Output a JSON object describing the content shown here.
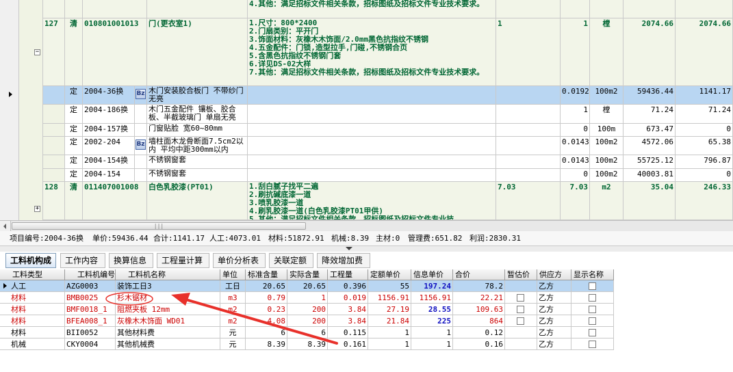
{
  "top_grid": {
    "row0_desc": "4.其他：满足招标文件相关条款，招标图纸及招标文件专业技术要求。",
    "row127": {
      "num": "127",
      "kind": "清",
      "code": "010801001013",
      "name": "门(更衣室1)",
      "desc": "1.尺寸：800*2400\n2.门扇类别：平开门\n3.饰面材料：灰橡木木饰面/2.0mm黑色抗指纹不锈钢\n4.五金配件：门锁,造型拉手,门碰,不锈钢合页\n5.含黑色抗指纹不锈钢门套\n6.详见DS-02大样\n7.其他：满足招标文件相关条款，招标图纸及招标文件专业技术要求。",
      "qty_expr": "1",
      "qty": "1",
      "unit": "樘",
      "price": "2074.66",
      "total": "2074.66",
      "toggle": "−"
    },
    "subrows": [
      {
        "kind": "定",
        "code": "2004-36换",
        "bz": "Bz",
        "name": "木门安装胶合板门 不带纱门 无亮",
        "qty": "0.0192",
        "unit": "100m2",
        "price": "59436.44",
        "total": "1141.17"
      },
      {
        "kind": "定",
        "code": "2004-186换",
        "bz": "",
        "name": "木门五金配件 镶板、胶合板、半截玻璃门 单扇无亮",
        "qty": "1",
        "unit": "樘",
        "price": "71.24",
        "total": "71.24"
      },
      {
        "kind": "定",
        "code": "2004-157换",
        "bz": "",
        "name": "门窗贴脸 宽60~80mm",
        "qty": "0",
        "unit": "100m",
        "price": "673.47",
        "total": "0"
      },
      {
        "kind": "定",
        "code": "2002-204",
        "bz": "Bz",
        "name": "墙柱面木龙骨断面7.5cm2以内 平均中距300mm以内",
        "qty": "0.0143",
        "unit": "100m2",
        "price": "4572.06",
        "total": "65.38"
      },
      {
        "kind": "定",
        "code": "2004-154换",
        "bz": "",
        "name": "不锈钢窗套",
        "qty": "0.0143",
        "unit": "100m2",
        "price": "55725.12",
        "total": "796.87"
      },
      {
        "kind": "定",
        "code": "2004-154",
        "bz": "",
        "name": "不锈钢窗套",
        "qty": "0",
        "unit": "100m2",
        "price": "40003.81",
        "total": "0"
      }
    ],
    "row128": {
      "num": "128",
      "kind": "清",
      "code": "011407001008",
      "name": "白色乳胶漆(PT01)",
      "desc": "1.刮白腻子找平二遍\n2.刷抗碱底漆一道\n3.喷乳胶漆一道\n4.刷乳胶漆一道(白色乳胶漆PT01甲供)\n5.其他：满足招标文件相关条款，招标图纸及招标文件专业技",
      "qty_expr": "7.03",
      "qty": "7.03",
      "unit": "m2",
      "price": "35.04",
      "total": "246.33",
      "toggle": "+"
    },
    "scroll_grip": "|||"
  },
  "summary": {
    "item_code": "项目编号:2004-36换",
    "unit_price": "单价:59436.44",
    "total": "合计:1141.17",
    "labor": "人工:4073.01",
    "material": "材料:51872.91",
    "machine": "机械:8.39",
    "main_material": "主材:0",
    "mgmt_fee": "管理费:651.82",
    "profit": "利润:2830.31"
  },
  "tabs": [
    "工料机构成",
    "工作内容",
    "换算信息",
    "工程量计算",
    "单价分析表",
    "关联定额",
    "降效增加费"
  ],
  "bottom_grid": {
    "headers": [
      "工料类型",
      "工料机编号",
      "工料机名称",
      "单位",
      "标准含量",
      "实际含量",
      "工程量",
      "定额单价",
      "信息单价",
      "合价",
      "暂估价",
      "供应方",
      "显示名称"
    ],
    "rows": [
      {
        "type": "人工",
        "code": "AZG0003",
        "name": "装饰工日3",
        "unit": "工日",
        "std": "20.65",
        "act": "20.65",
        "qty": "0.396",
        "quota": "55",
        "info": "197.24",
        "sum": "78.2",
        "supplier": "乙方",
        "est": false
      },
      {
        "type": "材料",
        "code": "BMB0025",
        "name": "杉木锯材",
        "unit": "m3",
        "std": "0.79",
        "act": "1",
        "qty": "0.019",
        "quota": "1156.91",
        "info": "1156.91",
        "sum": "22.21",
        "supplier": "乙方",
        "est": true
      },
      {
        "type": "材料",
        "code": "BMF0018_1",
        "name": "阻燃夹板 12mm",
        "unit": "m2",
        "std": "0.23",
        "act": "200",
        "qty": "3.84",
        "quota": "27.19",
        "info": "28.55",
        "sum": "109.63",
        "supplier": "乙方",
        "est": true
      },
      {
        "type": "材料",
        "code": "BFEA008_1",
        "name": "灰橡木木饰面 WD01",
        "unit": "m2",
        "std": "4.08",
        "act": "200",
        "qty": "3.84",
        "quota": "21.84",
        "info": "225",
        "sum": "864",
        "supplier": "乙方",
        "est": true
      },
      {
        "type": "材料",
        "code": "BII0052",
        "name": "其他材料费",
        "unit": "元",
        "std": "6",
        "act": "6",
        "qty": "0.115",
        "quota": "1",
        "info": "1",
        "sum": "0.12",
        "supplier": "乙方",
        "est": false
      },
      {
        "type": "机械",
        "code": "CKY0004",
        "name": "其他机械费",
        "unit": "元",
        "std": "8.39",
        "act": "8.39",
        "qty": "0.161",
        "quota": "1",
        "info": "1",
        "sum": "0.16",
        "supplier": "乙方",
        "est": false
      }
    ]
  },
  "colors": {
    "selected": "#b9d6f2",
    "green_text": "#006633",
    "red_text": "#cc0000",
    "blue_text": "#1010c0",
    "annotation": "#e8302a",
    "tree_bg": "#f0f3e4"
  }
}
